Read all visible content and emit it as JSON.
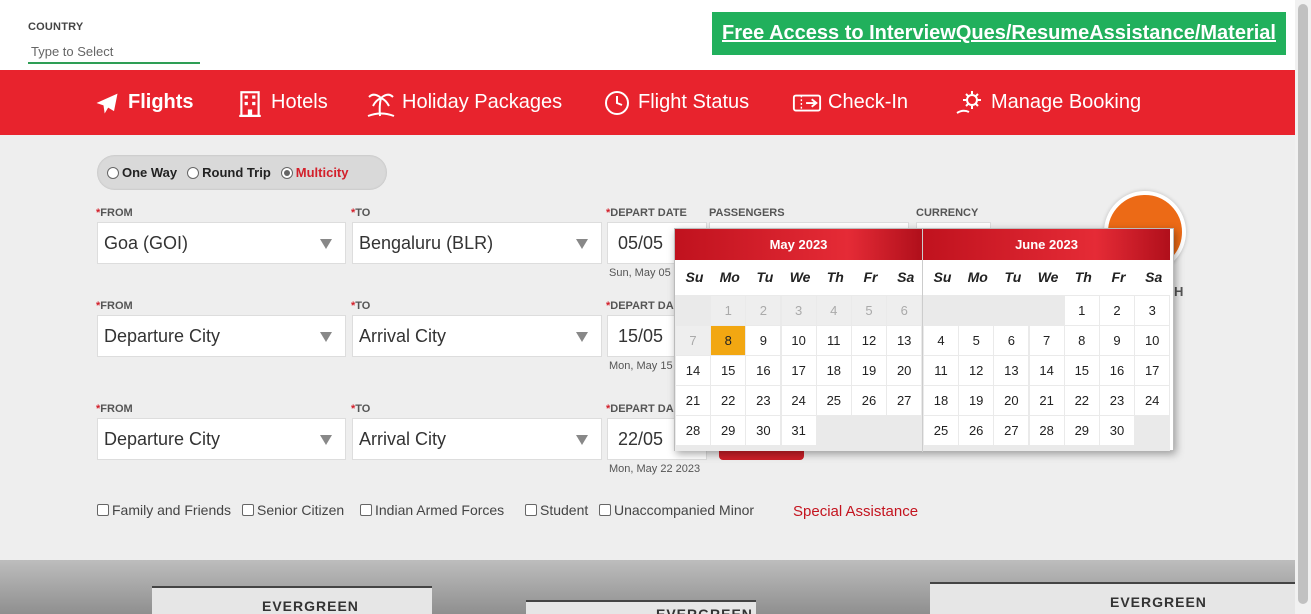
{
  "country": {
    "label": "COUNTRY",
    "placeholder": "Type to Select"
  },
  "promo": {
    "text": "Free Access to InterviewQues/ResumeAssistance/Material"
  },
  "nav": {
    "flights": "Flights",
    "hotels": "Hotels",
    "holidays": "Holiday Packages",
    "status": "Flight Status",
    "checkin": "Check-In",
    "manage": "Manage Booking"
  },
  "trip": {
    "oneway": "One Way",
    "round": "Round Trip",
    "multi": "Multicity"
  },
  "labels": {
    "from": "FROM",
    "to": "TO",
    "depart_date": "DEPART DATE",
    "depart_short": "DEPART DA",
    "passengers": "PASSENGERS",
    "currency": "CURRENCY",
    "search_hint": "H"
  },
  "legs": [
    {
      "from": "Goa (GOI)",
      "to": "Bengaluru (BLR)",
      "date": "05/05",
      "date_sub": "Sun, May 05"
    },
    {
      "from": "Departure City",
      "to": "Arrival City",
      "date": "15/05",
      "date_sub": "Mon, May 15"
    },
    {
      "from": "Departure City",
      "to": "Arrival City",
      "date": "22/05",
      "date_sub": "Mon, May 22 2023"
    }
  ],
  "checkboxes": [
    "Family and Friends",
    "Senior Citizen",
    "Indian Armed Forces",
    "Student",
    "Unaccompanied Minor"
  ],
  "special_assistance": "Special Assistance",
  "photo_signs": [
    "EVERGREEN",
    "EVERGREEN",
    "EVERGREEN"
  ],
  "calendar": {
    "dows": [
      "Su",
      "Mo",
      "Tu",
      "We",
      "Th",
      "Fr",
      "Sa"
    ],
    "months": [
      {
        "title": "May 2023",
        "rows": [
          [
            null,
            "1",
            "2",
            "3",
            "4",
            "5",
            "6"
          ],
          [
            "7",
            "8",
            "9",
            "10",
            "11",
            "12",
            "13"
          ],
          [
            "14",
            "15",
            "16",
            "17",
            "18",
            "19",
            "20"
          ],
          [
            "21",
            "22",
            "23",
            "24",
            "25",
            "26",
            "27"
          ],
          [
            "28",
            "29",
            "30",
            "31",
            null,
            null,
            null
          ]
        ],
        "disabled": [
          "1",
          "2",
          "3",
          "4",
          "5",
          "6",
          "7"
        ],
        "selected": "8"
      },
      {
        "title": "June 2023",
        "rows": [
          [
            null,
            null,
            null,
            null,
            "1",
            "2",
            "3"
          ],
          [
            "4",
            "5",
            "6",
            "7",
            "8",
            "9",
            "10"
          ],
          [
            "11",
            "12",
            "13",
            "14",
            "15",
            "16",
            "17"
          ],
          [
            "18",
            "19",
            "20",
            "21",
            "22",
            "23",
            "24"
          ],
          [
            "25",
            "26",
            "27",
            "28",
            "29",
            "30",
            null
          ]
        ],
        "disabled": [],
        "selected": null
      }
    ]
  },
  "colors": {
    "nav_red": "#e8232d",
    "promo_green": "#21b05c",
    "selected_day": "#f2a712",
    "search_orange": "#ec6a16"
  }
}
